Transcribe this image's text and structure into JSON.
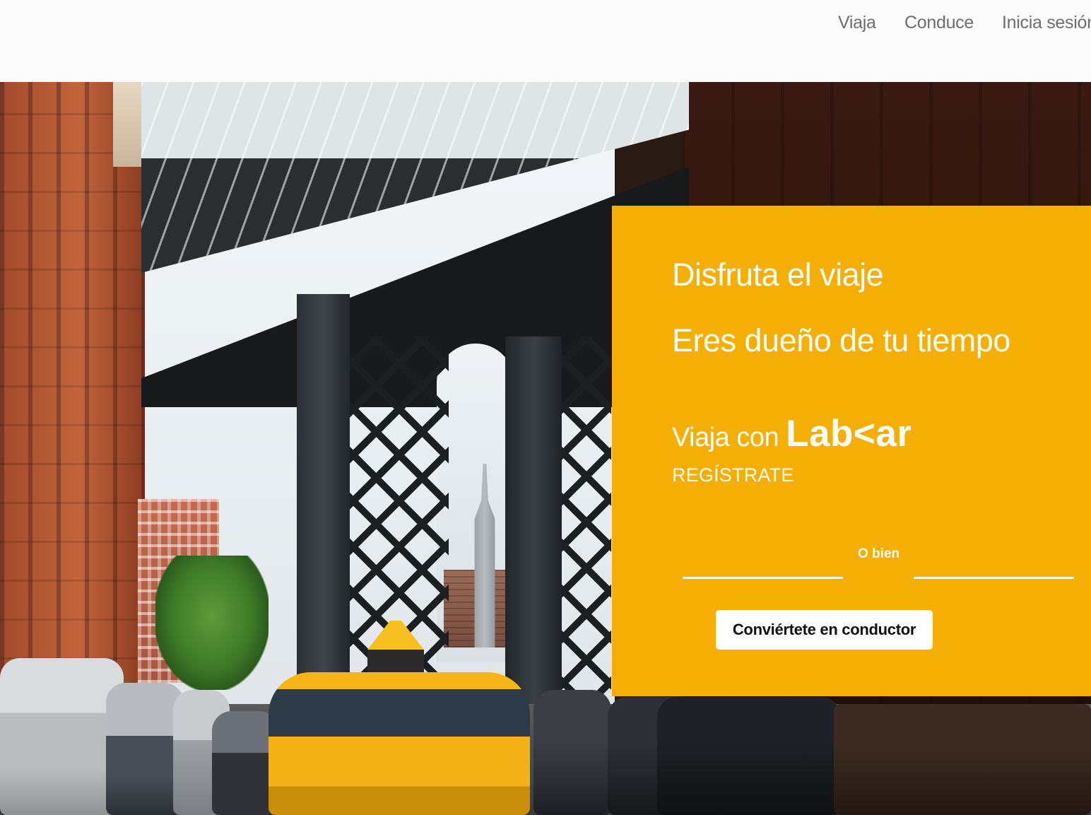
{
  "nav": {
    "links": [
      {
        "label": "Viaja"
      },
      {
        "label": "Conduce"
      },
      {
        "label": "Inicia sesión"
      }
    ]
  },
  "promo": {
    "line1": "Disfruta el viaje",
    "line2": "Eres dueño de tu tiempo",
    "brand_prefix": "Viaja con",
    "brand_logo": "Lab<ar",
    "register_label": "REGÍSTRATE",
    "or_label": "O bien",
    "driver_button_label": "Conviértete en conductor"
  },
  "colors": {
    "promo_background": "#f5af04",
    "nav_text": "#6e6e6e",
    "promo_text": "#ffffff"
  }
}
